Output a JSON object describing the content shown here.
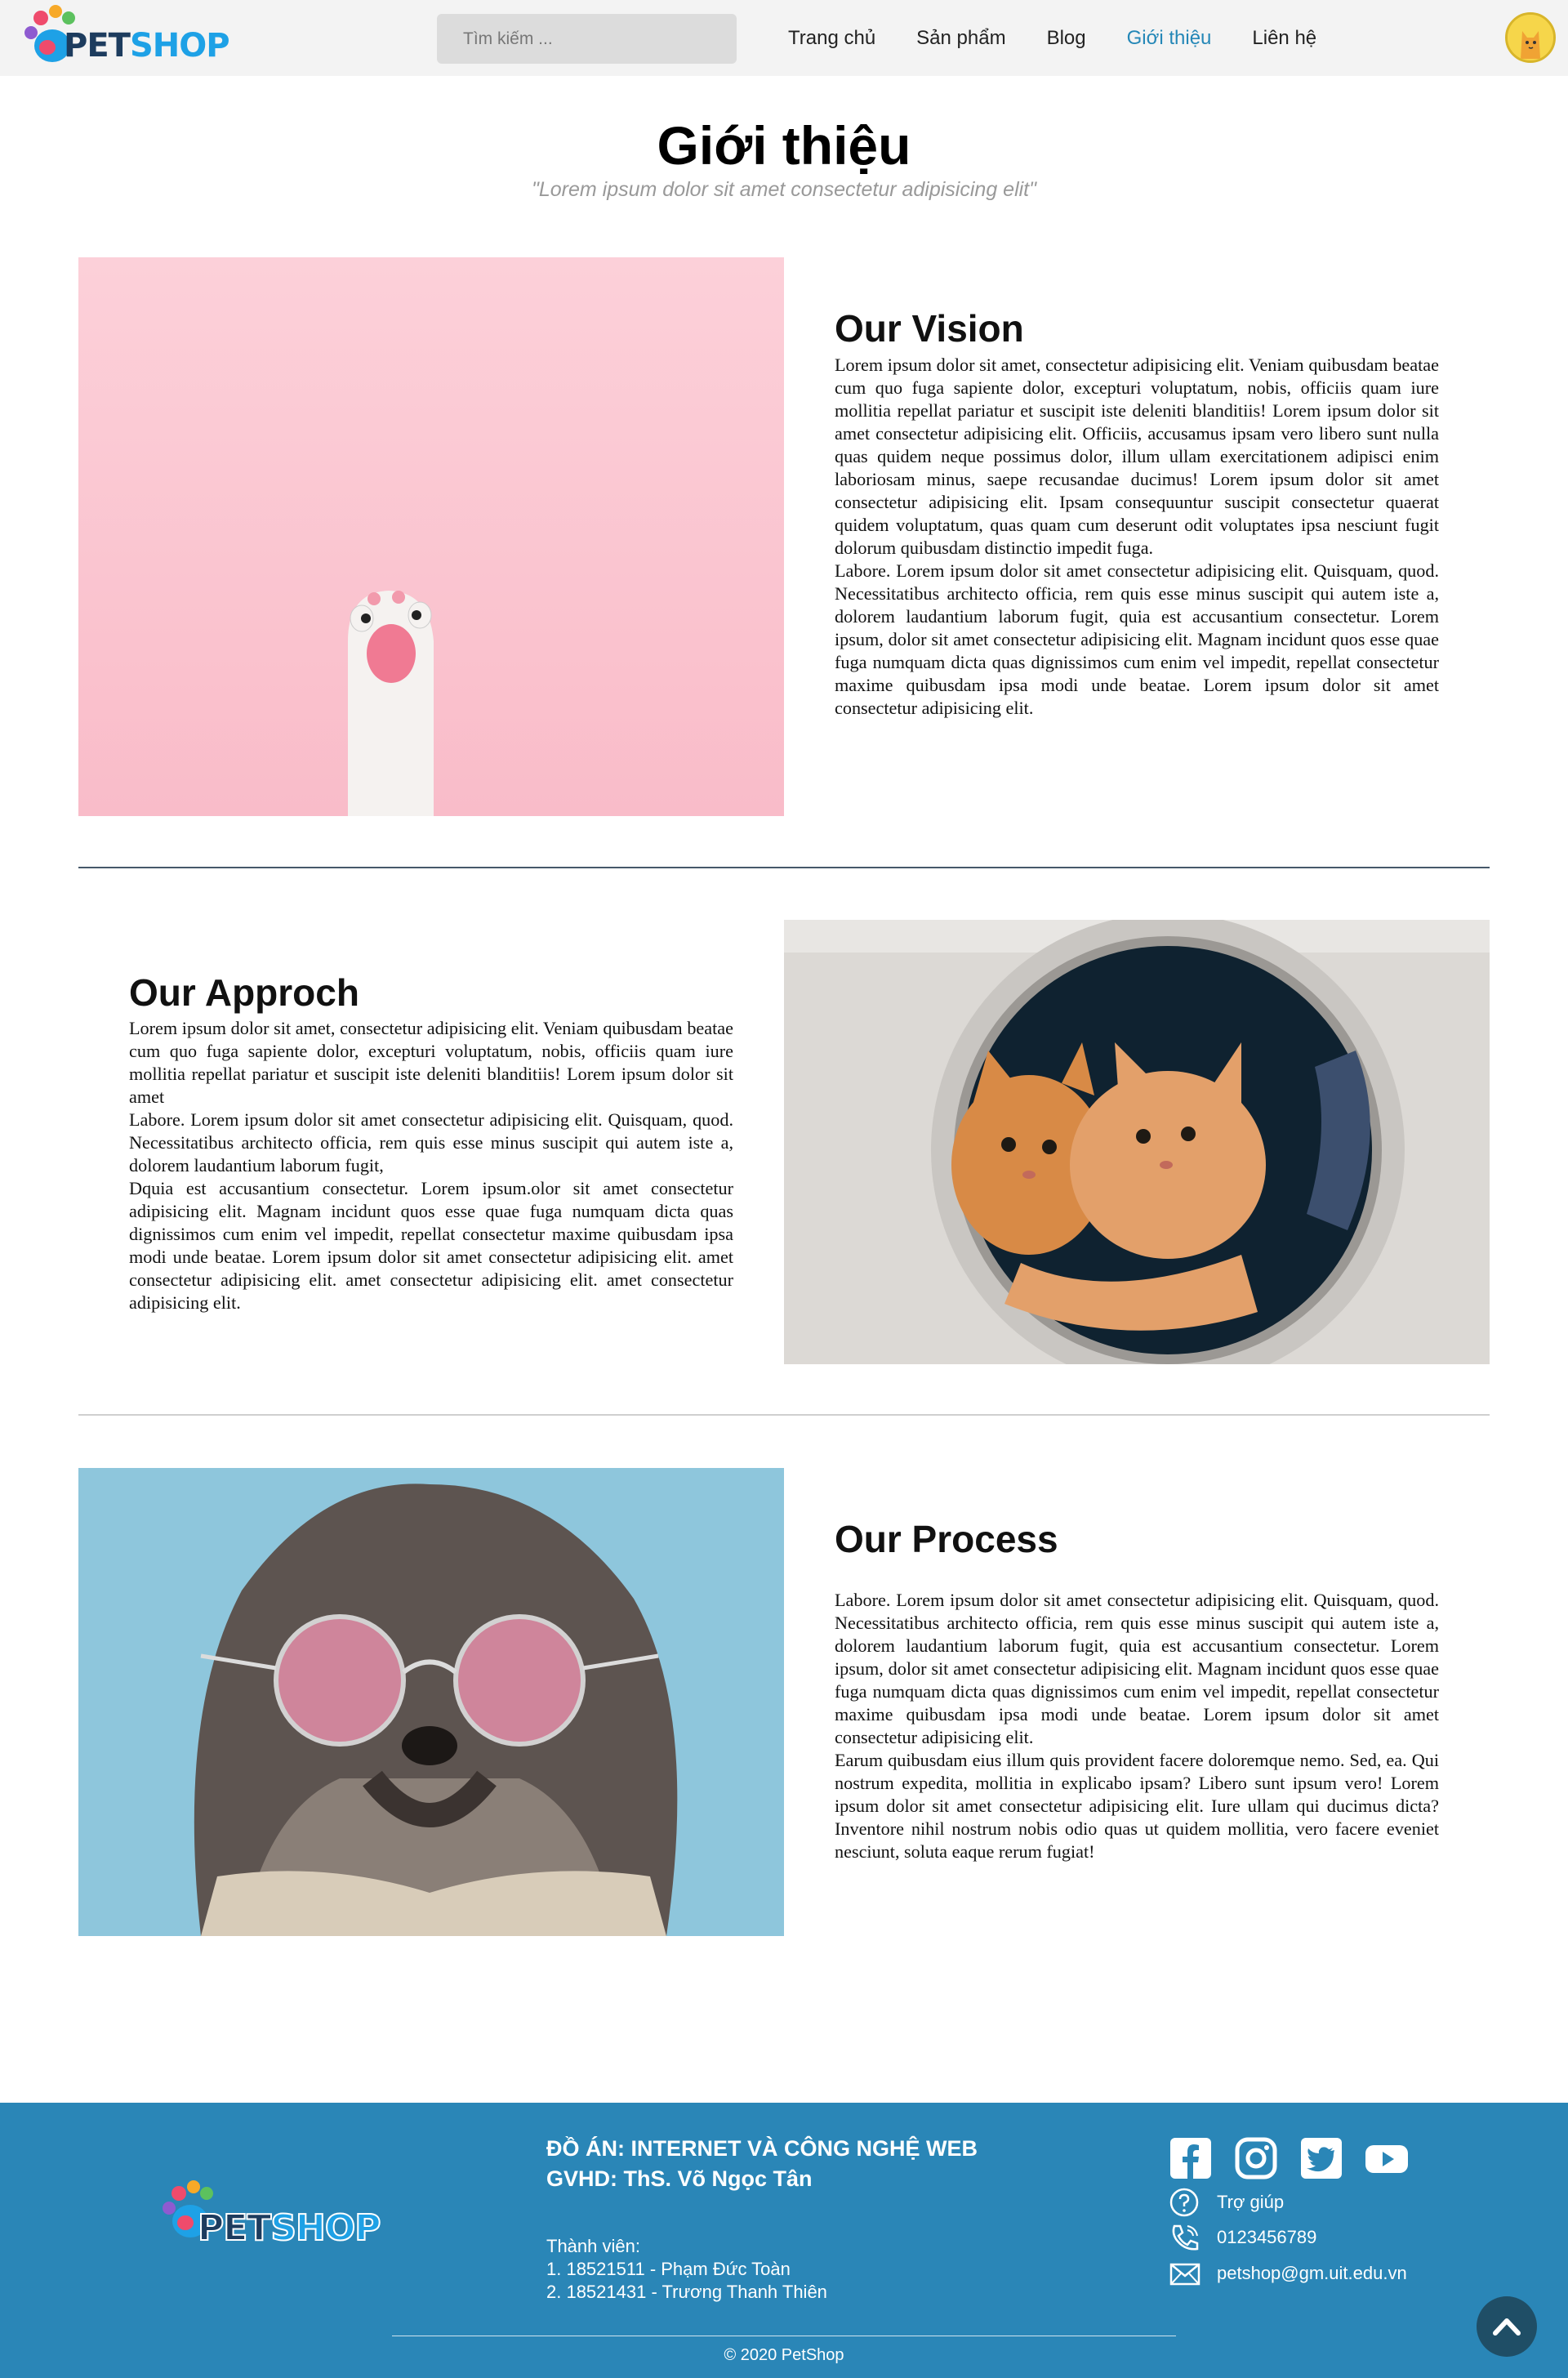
{
  "header": {
    "logo": {
      "pet": "PET",
      "shop": "SHOP"
    },
    "search_placeholder": "Tìm kiếm ...",
    "nav": [
      "Trang chủ",
      "Sản phẩm",
      "Blog",
      "Giới thiệu",
      "Liên hệ"
    ],
    "active_nav": "Giới thiệu"
  },
  "page": {
    "title": "Giới thiệu",
    "subtitle": "\"Lorem ipsum dolor sit amet consectetur adipisicing elit\""
  },
  "sections": [
    {
      "heading": "Our Vision",
      "paragraphs": [
        "Lorem ipsum dolor sit amet, consectetur adipisicing elit. Veniam quibusdam beatae cum quo fuga sapiente dolor, excepturi voluptatum, nobis, officiis quam iure mollitia repellat pariatur et suscipit iste deleniti blanditiis! Lorem ipsum dolor sit amet consectetur adipisicing elit. Officiis, accusamus ipsam vero libero sunt nulla quas quidem neque possimus dolor, illum ullam exercitationem adipisci enim laboriosam minus, saepe recusandae ducimus! Lorem ipsum dolor sit amet consectetur adipisicing elit. Ipsam consequuntur suscipit consectetur quaerat quidem voluptatum, quas quam cum deserunt odit voluptates ipsa nesciunt fugit dolorum quibusdam distinctio impedit fuga.",
        "Labore. Lorem ipsum dolor sit amet consectetur adipisicing elit. Quisquam, quod. Necessitatibus architecto officia, rem quis esse minus suscipit qui autem iste a, dolorem laudantium laborum fugit, quia est accusantium consectetur. Lorem ipsum, dolor sit amet consectetur adipisicing elit. Magnam incidunt quos esse quae fuga numquam dicta quas dignissimos cum enim vel impedit, repellat consectetur maxime quibusdam ipsa modi unde beatae. Lorem ipsum dolor sit amet consectetur adipisicing elit."
      ]
    },
    {
      "heading": "Our Approch",
      "paragraphs": [
        "Lorem ipsum dolor sit amet, consectetur adipisicing elit. Veniam quibusdam beatae cum quo fuga sapiente dolor, excepturi voluptatum, nobis, officiis quam iure mollitia repellat pariatur et suscipit iste deleniti blanditiis! Lorem ipsum dolor sit amet",
        "Labore. Lorem ipsum dolor sit amet consectetur adipisicing elit. Quisquam, quod. Necessitatibus architecto officia, rem quis esse minus suscipit qui autem iste a, dolorem laudantium laborum fugit,",
        "Dquia est accusantium consectetur. Lorem ipsum.olor sit amet consectetur adipisicing elit. Magnam incidunt quos esse quae fuga numquam dicta quas dignissimos cum enim vel impedit, repellat consectetur maxime quibusdam ipsa modi unde beatae. Lorem ipsum dolor sit amet consectetur adipisicing elit. amet consectetur adipisicing elit. amet consectetur adipisicing elit. amet consectetur adipisicing elit."
      ]
    },
    {
      "heading": "Our Process",
      "paragraphs": [
        "Labore. Lorem ipsum dolor sit amet consectetur adipisicing elit. Quisquam, quod. Necessitatibus architecto officia, rem quis esse minus suscipit qui autem iste a, dolorem laudantium laborum fugit, quia est accusantium consectetur. Lorem ipsum, dolor sit amet consectetur adipisicing elit. Magnam incidunt quos esse quae fuga numquam dicta quas dignissimos cum enim vel impedit, repellat consectetur maxime quibusdam ipsa modi unde beatae. Lorem ipsum dolor sit amet consectetur adipisicing elit.",
        "Earum quibusdam eius illum quis provident facere doloremque nemo. Sed, ea. Qui nostrum expedita, mollitia in explicabo ipsam? Libero sunt ipsum vero! Lorem ipsum dolor sit amet consectetur adipisicing elit. Iure ullam qui ducimus dicta? Inventore nihil nostrum nobis odio quas ut quidem mollitia, vero facere eveniet nesciunt, soluta eaque rerum fugiat!"
      ]
    }
  ],
  "footer": {
    "project_line1": "ĐỒ ÁN: INTERNET VÀ CÔNG NGHỆ WEB",
    "project_line2": "GVHD: ThS. Võ Ngọc Tân",
    "members_label": "Thành viên:",
    "members": [
      "1. 18521511 - Phạm Đức Toàn",
      "2. 18521431 - Trương Thanh Thiên"
    ],
    "socials": [
      "facebook-icon",
      "instagram-icon",
      "twitter-icon",
      "youtube-icon"
    ],
    "help": "Trợ giúp",
    "phone": "0123456789",
    "email": "petshop@gm.uit.edu.vn",
    "copyright": "© 2020 PetShop"
  },
  "colors": {
    "header_bg": "#f3f3f3",
    "nav_active": "#2487b7",
    "footer_bg": "#2a86b7",
    "scroll_top_bg": "#1f4e66",
    "vision_img_bg": "#fcc9d3",
    "process_img_bg": "#8ec6dc"
  }
}
